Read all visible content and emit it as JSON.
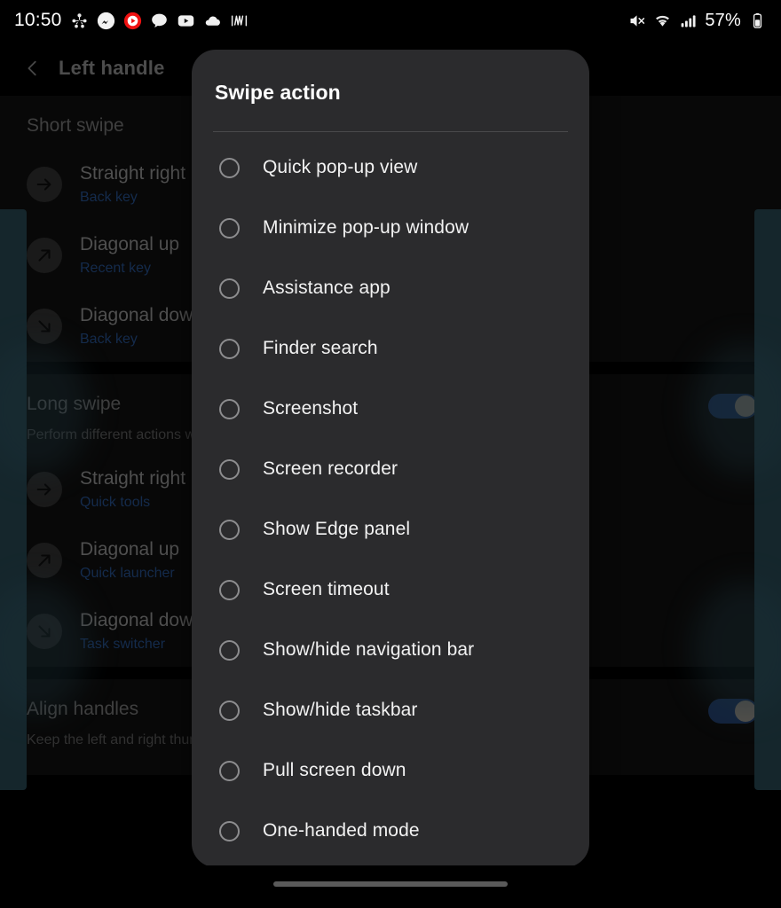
{
  "status_bar": {
    "time": "10:50",
    "battery_percent": "57%",
    "notification_icons": [
      "sharing-network-icon",
      "messenger-icon",
      "youtube-music-icon",
      "kakaotalk-icon",
      "youtube-icon",
      "cloud-icon",
      "waveform-icon"
    ],
    "right_icons": [
      "mute-icon",
      "wifi-icon",
      "signal-icon",
      "battery-icon"
    ]
  },
  "background_page": {
    "back_icon": "back-chevron-icon",
    "title": "Left handle",
    "sections": [
      {
        "title": "Short swipe",
        "subtitle": "",
        "has_toggle": false,
        "rows": [
          {
            "icon": "arrow-right-icon",
            "title": "Straight right",
            "value": "Back key"
          },
          {
            "icon": "arrow-up-right-icon",
            "title": "Diagonal up",
            "value": "Recent key"
          },
          {
            "icon": "arrow-down-right-icon",
            "title": "Diagonal down",
            "value": "Back key"
          }
        ]
      },
      {
        "title": "Long swipe",
        "subtitle": "Perform different actions when you swipe farther on the screen.",
        "has_toggle": true,
        "toggle_on": true,
        "rows": [
          {
            "icon": "arrow-right-icon",
            "title": "Straight right",
            "value": "Quick tools"
          },
          {
            "icon": "arrow-up-right-icon",
            "title": "Diagonal up",
            "value": "Quick launcher"
          },
          {
            "icon": "arrow-down-right-icon",
            "title": "Diagonal down",
            "value": "Task switcher"
          }
        ]
      },
      {
        "title": "Align handles",
        "subtitle": "Keep the left and right thumb handles aligned.",
        "has_toggle": true,
        "toggle_on": true,
        "rows": []
      }
    ]
  },
  "dialog": {
    "title": "Swipe action",
    "options": [
      {
        "label": "Quick pop-up view",
        "selected": false
      },
      {
        "label": "Minimize pop-up window",
        "selected": false
      },
      {
        "label": "Assistance app",
        "selected": false
      },
      {
        "label": "Finder search",
        "selected": false
      },
      {
        "label": "Screenshot",
        "selected": false
      },
      {
        "label": "Screen recorder",
        "selected": false
      },
      {
        "label": "Show Edge panel",
        "selected": false
      },
      {
        "label": "Screen timeout",
        "selected": false
      },
      {
        "label": "Show/hide navigation bar",
        "selected": false
      },
      {
        "label": "Show/hide taskbar",
        "selected": false
      },
      {
        "label": "Pull screen down",
        "selected": false
      },
      {
        "label": "One-handed mode",
        "selected": false
      }
    ]
  },
  "nav_bar": {
    "gesture_pill": "gesture-handle"
  },
  "colors": {
    "dialog_bg": "#2B2B2D",
    "screen_bg": "#000000",
    "card_bg": "#121212",
    "accent_value_text": "#2D5FA8",
    "toggle_on": "#2A4D86",
    "edge_panel": "#2F5562"
  }
}
